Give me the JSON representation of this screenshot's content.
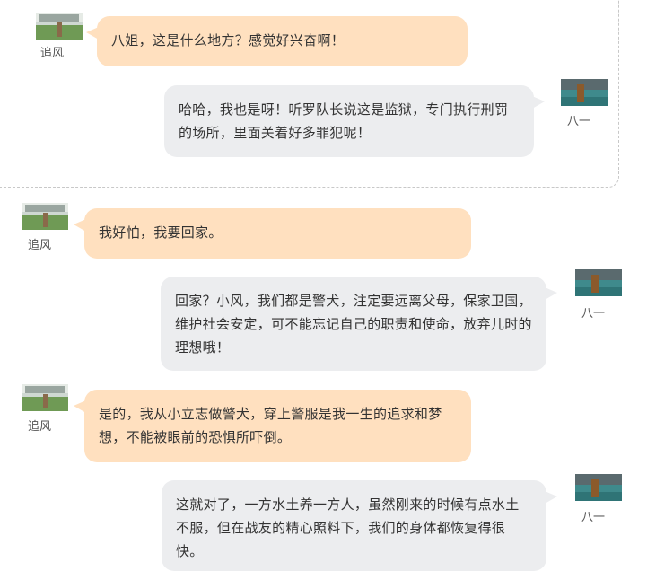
{
  "users": {
    "left_name": "追风",
    "right_name": "八一",
    "left_avatar_icon": "field-photo-avatar-icon",
    "right_avatar_icon": "gym-photo-avatar-icon"
  },
  "colors": {
    "left_bubble": "#ffe0bf",
    "right_bubble": "#ecedef",
    "divider": "#c8c8c8"
  },
  "messages": [
    {
      "side": "left",
      "text": "八姐，这是什么地方？感觉好兴奋啊！"
    },
    {
      "side": "right",
      "text": "哈哈，我也是呀！听罗队长说这是监狱，专门执行刑罚的场所，里面关着好多罪犯呢！"
    },
    {
      "side": "left",
      "text": "我好怕，我要回家。"
    },
    {
      "side": "right",
      "text": "回家？小风，我们都是警犬，注定要远离父母，保家卫国，维护社会安定，可不能忘记自己的职责和使命，放弃儿时的理想哦！"
    },
    {
      "side": "left",
      "text": "是的，我从小立志做警犬，穿上警服是我一生的追求和梦想，不能被眼前的恐惧所吓倒。"
    },
    {
      "side": "right",
      "text": "这就对了，一方水土养一方人，虽然刚来的时候有点水土不服，但在战友的精心照料下，我们的身体都恢复得很快。"
    }
  ]
}
